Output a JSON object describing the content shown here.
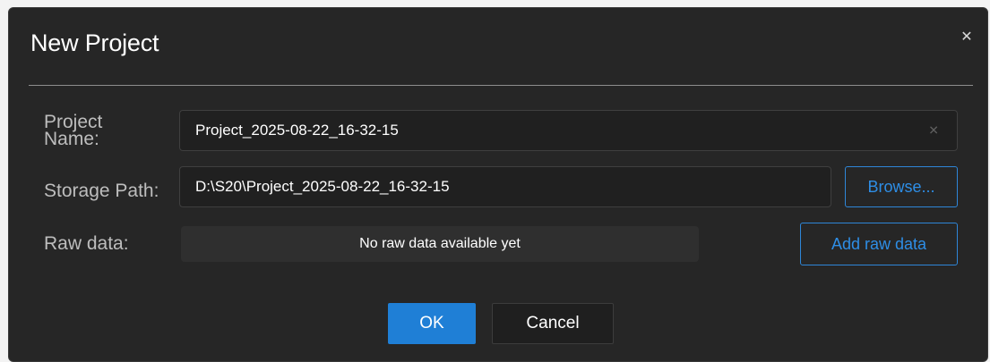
{
  "dialog": {
    "title": "New Project",
    "close_icon": "close-icon"
  },
  "form": {
    "project_name_label": "Project Name:",
    "project_name_label_line1": "Project",
    "project_name_label_line2": "Name:",
    "project_name_value": "Project_2025-08-22_16-32-15",
    "storage_path_label": "Storage Path:",
    "storage_path_value": "D:\\S20\\Project_2025-08-22_16-32-15",
    "raw_data_label": "Raw data:",
    "raw_data_status": "No raw data available yet"
  },
  "buttons": {
    "browse": "Browse...",
    "add_raw_data": "Add raw data",
    "ok": "OK",
    "cancel": "Cancel"
  },
  "colors": {
    "dialog_bg": "#262626",
    "accent": "#1f7fd6",
    "text": "#ffffff",
    "label": "#bdbdbd"
  }
}
